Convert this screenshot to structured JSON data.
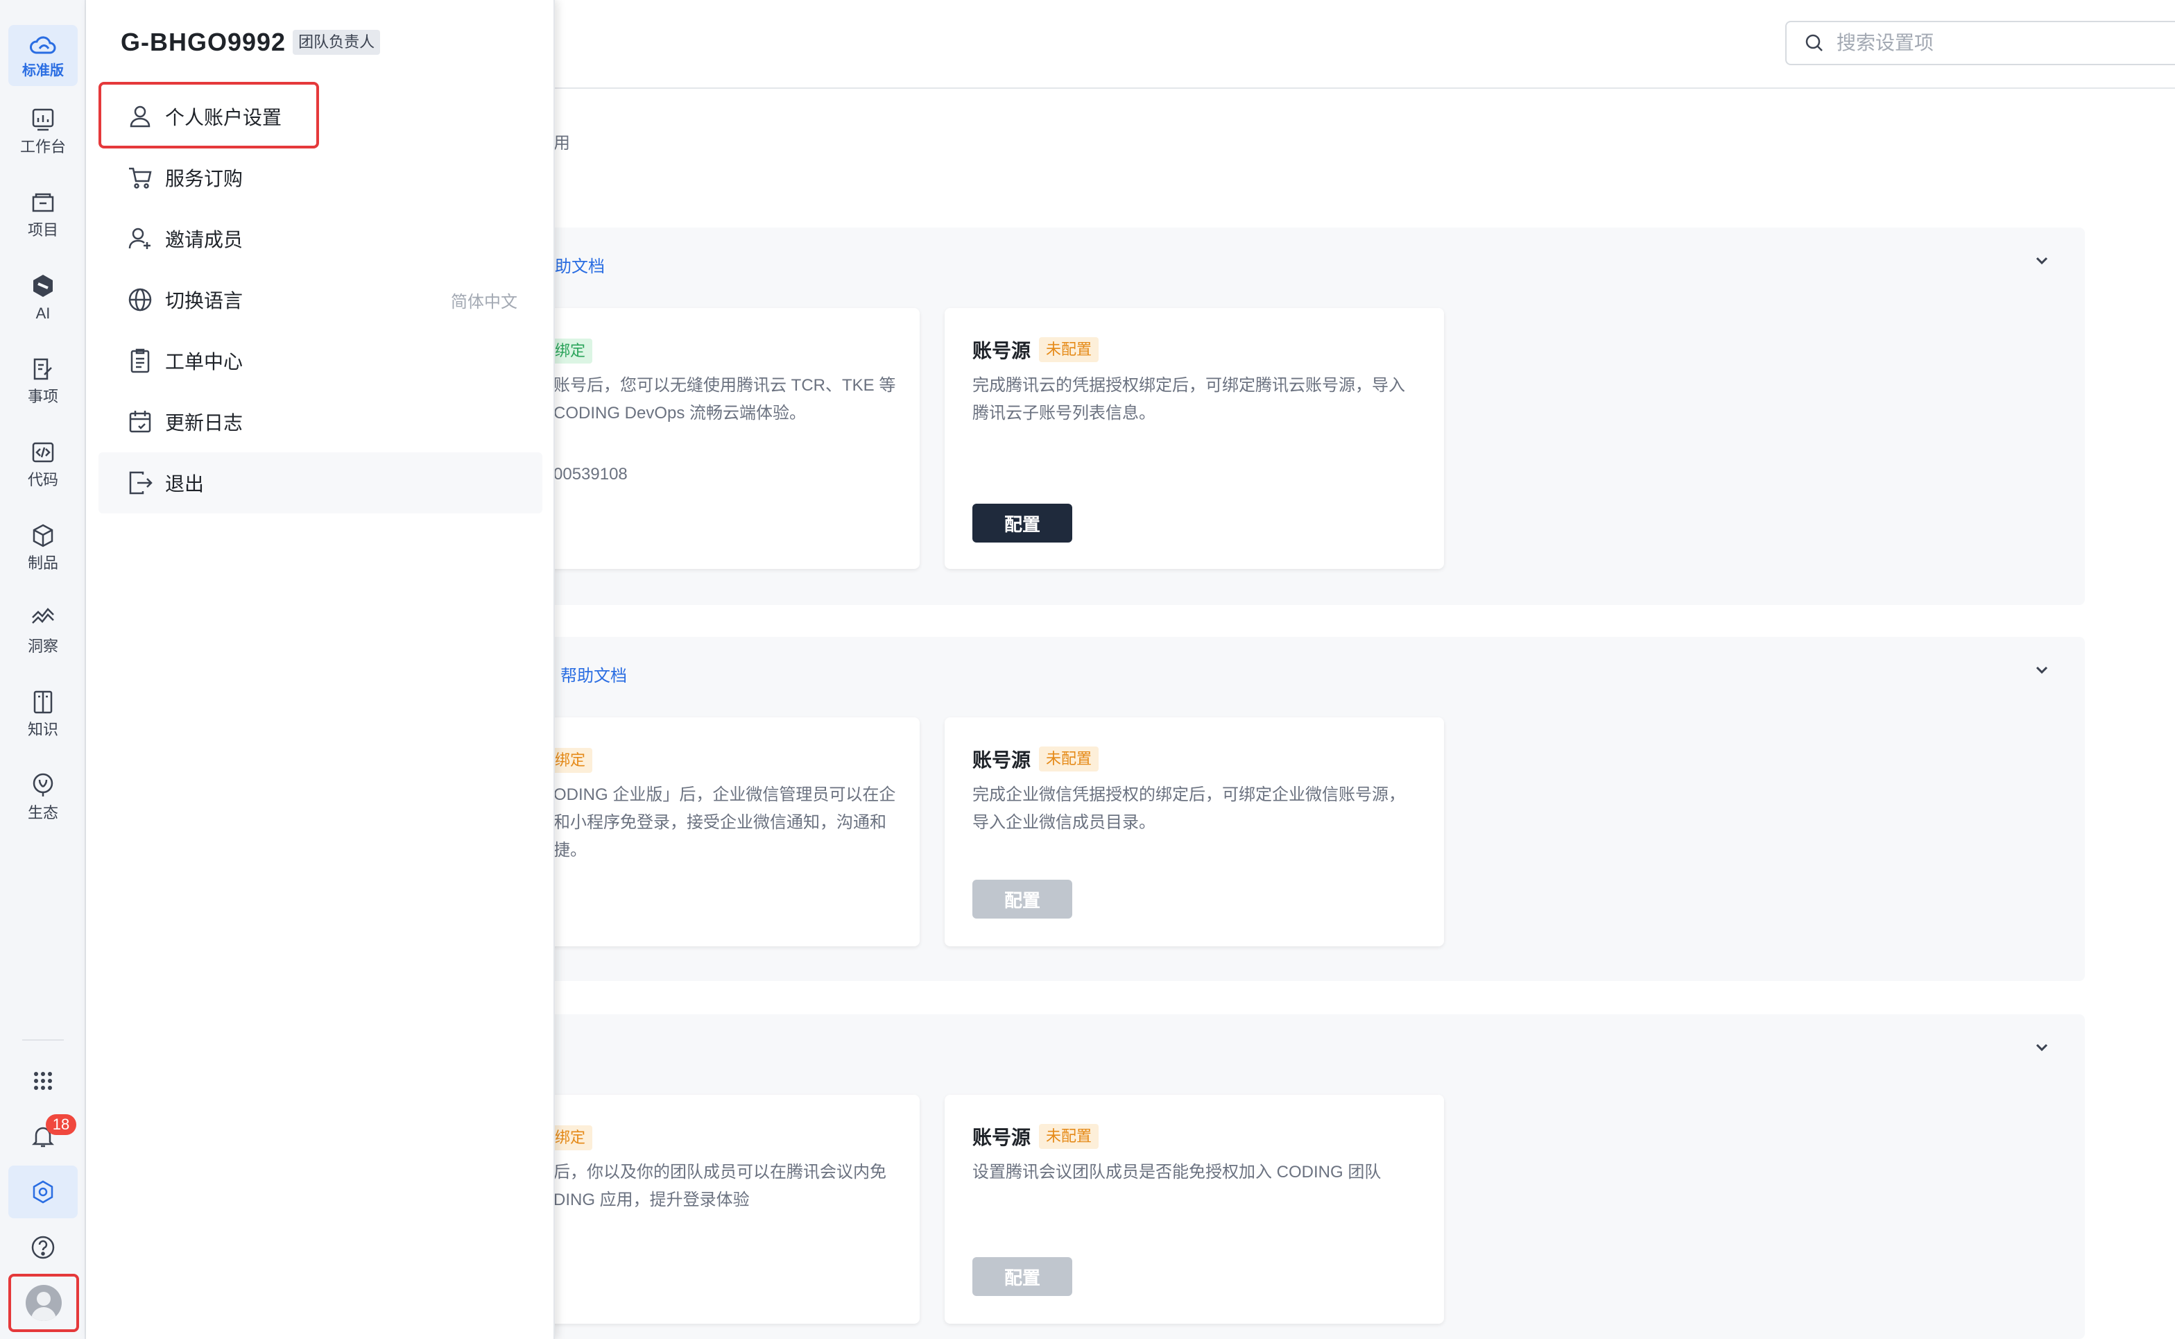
{
  "rail": {
    "brand_label": "标准版",
    "items": [
      {
        "label": "工作台",
        "icon": "dashboard-icon"
      },
      {
        "label": "项目",
        "icon": "folder-icon"
      },
      {
        "label": "AI",
        "icon": "ai-icon"
      },
      {
        "label": "事项",
        "icon": "issue-icon"
      },
      {
        "label": "代码",
        "icon": "code-icon"
      },
      {
        "label": "制品",
        "icon": "package-icon"
      },
      {
        "label": "洞察",
        "icon": "insight-icon"
      },
      {
        "label": "知识",
        "icon": "book-icon"
      },
      {
        "label": "生态",
        "icon": "ecosystem-icon"
      }
    ],
    "notification_count": "18"
  },
  "header": {
    "search_placeholder": "搜索设置项"
  },
  "content": {
    "partial_top": "用",
    "sections": [
      {
        "link": "助文档",
        "left_card": {
          "tag": "绑定",
          "lines": [
            "账号后，您可以无缝使用腾讯云 TCR、TKE 等",
            "CODING DevOps 流畅云端体验。",
            "",
            "00539108"
          ]
        },
        "right_card": {
          "title": "账号源",
          "tag": "未配置",
          "desc": "完成腾讯云的凭据授权绑定后，可绑定腾讯云账号源，导入腾讯云子账号列表信息。",
          "button": "配置"
        }
      },
      {
        "link": "帮助文档",
        "left_card": {
          "tag": "绑定",
          "lines": [
            "ODING 企业版」后，企业微信管理员可以在企",
            "和小程序免登录，接受企业微信通知，沟通和",
            "捷。"
          ]
        },
        "right_card": {
          "title": "账号源",
          "tag": "未配置",
          "desc": "完成企业微信凭据授权的绑定后，可绑定企业微信账号源，导入企业微信成员目录。",
          "button": "配置"
        }
      },
      {
        "link": "",
        "left_card": {
          "tag": "绑定",
          "lines": [
            "后，你以及你的团队成员可以在腾讯会议内免",
            "DING 应用，提升登录体验"
          ]
        },
        "right_card": {
          "title": "账号源",
          "tag": "未配置",
          "desc": "设置腾讯会议团队成员是否能免授权加入 CODING 团队",
          "button": "配置"
        }
      }
    ]
  },
  "panel": {
    "team_name": "G-BHGO9992",
    "role": "团队负责人",
    "menu": [
      {
        "label": "个人账户设置",
        "icon": "user-icon"
      },
      {
        "label": "服务订购",
        "icon": "cart-icon"
      },
      {
        "label": "邀请成员",
        "icon": "invite-user-icon"
      },
      {
        "label": "切换语言",
        "icon": "globe-icon",
        "extra": "简体中文"
      },
      {
        "label": "工单中心",
        "icon": "ticket-icon"
      },
      {
        "label": "更新日志",
        "icon": "calendar-icon"
      },
      {
        "label": "退出",
        "icon": "logout-icon"
      }
    ]
  },
  "colors": {
    "accent": "#2a6de2",
    "highlight_border": "#e5393b",
    "dark_button": "#1f2a3c"
  }
}
